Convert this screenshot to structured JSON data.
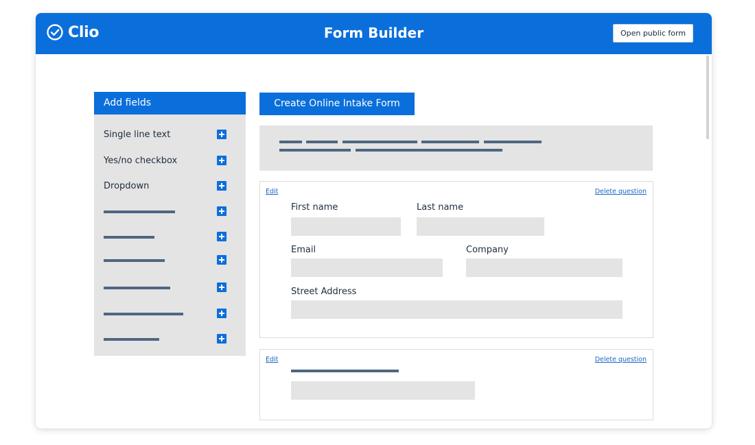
{
  "header": {
    "logo_text": "Clio",
    "title": "Form Builder",
    "open_public_form_label": "Open public form"
  },
  "sidebar": {
    "title": "Add fields",
    "items": [
      {
        "label": "Single line text"
      },
      {
        "label": "Yes/no checkbox"
      },
      {
        "label": "Dropdown"
      }
    ],
    "placeholder_item_count": 6
  },
  "form": {
    "title": "Create Online Intake Form",
    "cards": [
      {
        "edit_label": "Edit",
        "delete_label": "Delete question",
        "fields": {
          "first_name": "First name",
          "last_name": "Last name",
          "email": "Email",
          "company": "Company",
          "street_address": "Street Address"
        }
      },
      {
        "edit_label": "Edit",
        "delete_label": "Delete question"
      }
    ]
  },
  "colors": {
    "brand_blue": "#0a6fdb",
    "placeholder_bar": "#4e6680",
    "panel_gray": "#e4e4e4",
    "link_blue": "#1a66c6"
  }
}
